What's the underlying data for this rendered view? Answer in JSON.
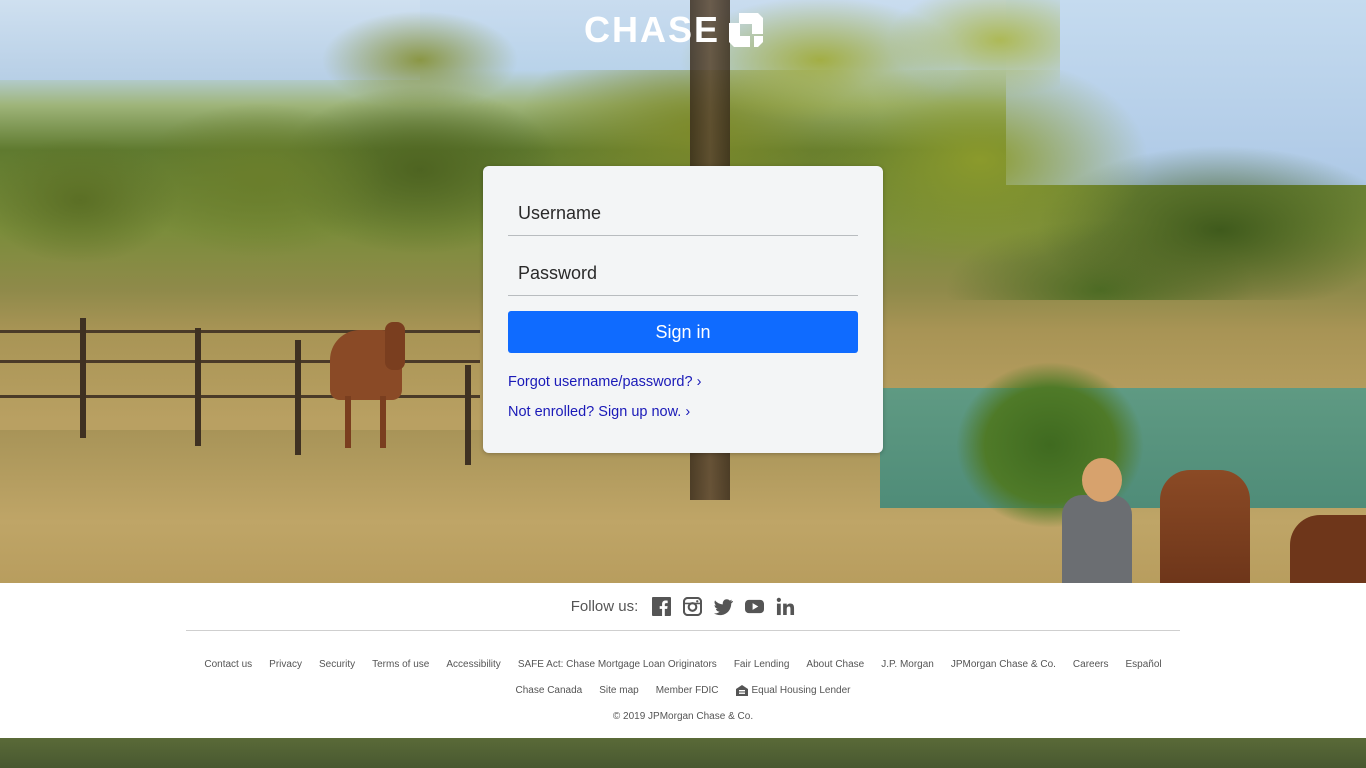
{
  "brand": {
    "name": "CHASE"
  },
  "login": {
    "username_placeholder": "Username",
    "password_placeholder": "Password",
    "signin_label": "Sign in",
    "forgot_link": "Forgot username/password? ›",
    "enroll_link": "Not enrolled? Sign up now. ›"
  },
  "footer": {
    "follow_label": "Follow us:",
    "social": [
      "facebook-icon",
      "instagram-icon",
      "twitter-icon",
      "youtube-icon",
      "linkedin-icon"
    ],
    "links_row1": [
      "Contact us",
      "Privacy",
      "Security",
      "Terms of use",
      "Accessibility",
      "SAFE Act: Chase Mortgage Loan Originators",
      "Fair Lending",
      "About Chase",
      "J.P. Morgan",
      "JPMorgan Chase & Co.",
      "Careers",
      "Español"
    ],
    "links_row2": [
      "Chase Canada",
      "Site map",
      "Member FDIC"
    ],
    "equal_housing": "Equal Housing Lender",
    "copyright": "© 2019 JPMorgan Chase & Co."
  },
  "colors": {
    "primary_button": "#0f6bff",
    "link": "#1a1ab8",
    "card_bg": "#f3f5f6"
  }
}
